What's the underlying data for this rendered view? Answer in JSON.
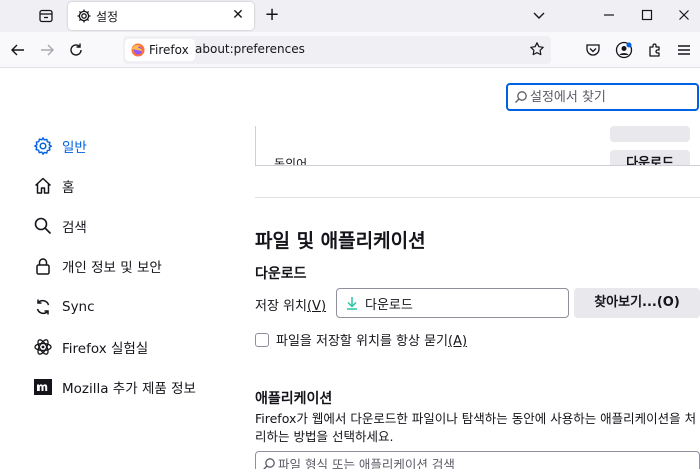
{
  "tab": {
    "title": "설정",
    "close_glyph": "✕"
  },
  "new_tab_glyph": "+",
  "urlbar": {
    "identity_label": "Firefox",
    "url": "about:preferences"
  },
  "search": {
    "placeholder": "설정에서 찾기"
  },
  "sidebar": {
    "items": [
      {
        "label": "일반",
        "icon": "gear-icon",
        "selected": true
      },
      {
        "label": "홈",
        "icon": "home-icon"
      },
      {
        "label": "검색",
        "icon": "search-icon"
      },
      {
        "label": "개인 정보 및 보안",
        "icon": "lock-icon"
      },
      {
        "label": "Sync",
        "icon": "sync-icon"
      },
      {
        "label": "Firefox 실험실",
        "icon": "flask-icon"
      },
      {
        "label": "Mozilla 추가 제품 정보",
        "icon": "mozilla-icon"
      }
    ]
  },
  "prev_section": {
    "partial_text": "동의어",
    "partial_button": "다운로드"
  },
  "files_apps": {
    "heading": "파일 및 애플리케이션",
    "downloads_heading": "다운로드",
    "save_to_label": "저장 위치",
    "save_to_accesskey": "(V)",
    "download_folder": "다운로드",
    "browse_button": "찾아보기...(O)",
    "ask_label": "파일을 저장할 위치를 항상 묻기",
    "ask_accesskey": "(A)",
    "ask_checked": false,
    "applications_heading": "애플리케이션",
    "applications_desc": "Firefox가 웹에서 다운로드한 파일이나 탐색하는 동안에 사용하는 애플리케이션을 처리하는 방법을 선택하세요.",
    "app_search_placeholder": "파일 형식 또는 애플리케이션 검색"
  },
  "colors": {
    "accent": "#0061e0",
    "download_arrow": "#2ac3a2",
    "text": "#15141a"
  }
}
